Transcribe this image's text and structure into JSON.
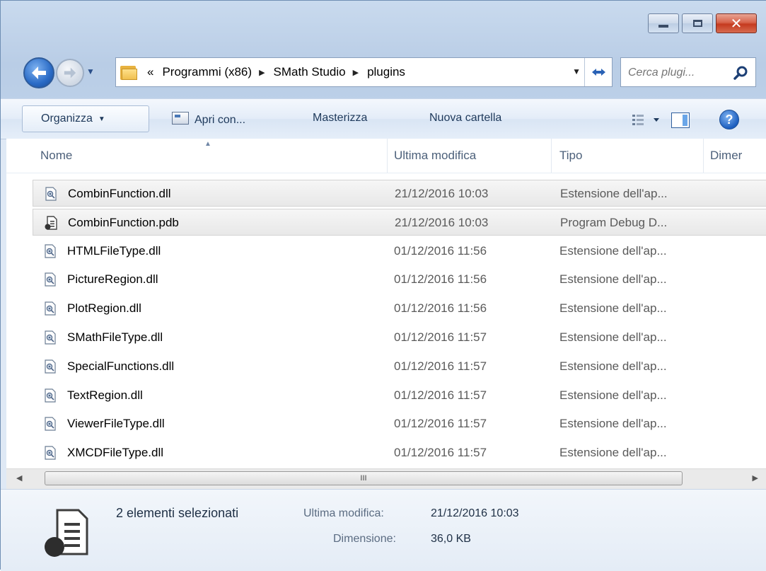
{
  "window": {
    "controls": {
      "minimize": "minimize",
      "maximize": "maximize",
      "close": "close"
    }
  },
  "address": {
    "overflow": "«",
    "crumbs": [
      "Programmi (x86)",
      "SMath Studio",
      "plugins"
    ]
  },
  "search": {
    "placeholder": "Cerca plugi..."
  },
  "toolbar": {
    "organize": "Organizza",
    "open_with": "Apri con...",
    "burn": "Masterizza",
    "new_folder": "Nuova cartella"
  },
  "columns": {
    "name": "Nome",
    "modified": "Ultima modifica",
    "type": "Tipo",
    "size": "Dimer"
  },
  "files": [
    {
      "name": "CombinFunction.dll",
      "modified": "21/12/2016 10:03",
      "type": "Estensione dell'ap...",
      "kind": "dll-icon",
      "selected": true
    },
    {
      "name": "CombinFunction.pdb",
      "modified": "21/12/2016 10:03",
      "type": "Program Debug D...",
      "kind": "pdb-icon",
      "selected": true
    },
    {
      "name": "HTMLFileType.dll",
      "modified": "01/12/2016 11:56",
      "type": "Estensione dell'ap...",
      "kind": "dll-icon",
      "selected": false
    },
    {
      "name": "PictureRegion.dll",
      "modified": "01/12/2016 11:56",
      "type": "Estensione dell'ap...",
      "kind": "dll-icon",
      "selected": false
    },
    {
      "name": "PlotRegion.dll",
      "modified": "01/12/2016 11:56",
      "type": "Estensione dell'ap...",
      "kind": "dll-icon",
      "selected": false
    },
    {
      "name": "SMathFileType.dll",
      "modified": "01/12/2016 11:57",
      "type": "Estensione dell'ap...",
      "kind": "dll-icon",
      "selected": false
    },
    {
      "name": "SpecialFunctions.dll",
      "modified": "01/12/2016 11:57",
      "type": "Estensione dell'ap...",
      "kind": "dll-icon",
      "selected": false
    },
    {
      "name": "TextRegion.dll",
      "modified": "01/12/2016 11:57",
      "type": "Estensione dell'ap...",
      "kind": "dll-icon",
      "selected": false
    },
    {
      "name": "ViewerFileType.dll",
      "modified": "01/12/2016 11:57",
      "type": "Estensione dell'ap...",
      "kind": "dll-icon",
      "selected": false
    },
    {
      "name": "XMCDFileType.dll",
      "modified": "01/12/2016 11:57",
      "type": "Estensione dell'ap...",
      "kind": "dll-icon",
      "selected": false
    }
  ],
  "scrollbar": {
    "grip": "III"
  },
  "details": {
    "selection": "2 elementi selezionati",
    "modified_label": "Ultima modifica:",
    "modified_value": "21/12/2016 10:03",
    "size_label": "Dimensione:",
    "size_value": "36,0 KB"
  },
  "colors": {
    "accent": "#2a6bc6",
    "frame": "#bcd0e8",
    "selection": "#e8e8e8"
  }
}
